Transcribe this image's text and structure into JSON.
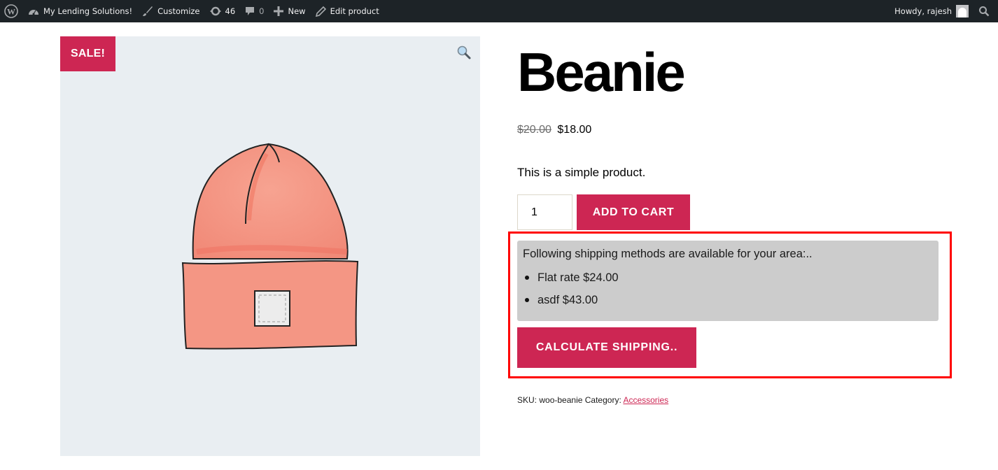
{
  "adminbar": {
    "wp_logo": "wordpress-icon",
    "site_name": "My Lending Solutions!",
    "customize": "Customize",
    "updates_count": "46",
    "comments_count": "0",
    "new": "New",
    "edit": "Edit product",
    "howdy": "Howdy, rajesh",
    "icons": {
      "site": "dashboard-icon",
      "customize": "paintbrush-icon",
      "updates": "refresh-icon",
      "comments": "comment-icon",
      "new": "plus-icon",
      "edit": "pencil-icon",
      "search": "search-icon"
    }
  },
  "gallery": {
    "sale_badge": "SALE!",
    "zoom_icon": "magnifier-icon",
    "image_alt": "Beanie illustration"
  },
  "product": {
    "title": "Beanie",
    "regular_price": "$20.00",
    "sale_price": "$18.00",
    "short_description": "This is a simple product.",
    "quantity": "1",
    "add_to_cart": "ADD TO CART"
  },
  "shipping": {
    "heading": "Following shipping methods are available for your area:..",
    "methods": [
      {
        "label": "Flat rate $24.00"
      },
      {
        "label": "asdf $43.00"
      }
    ],
    "calculate_button": "CALCULATE SHIPPING..",
    "highlight_color": "#ff0000"
  },
  "meta": {
    "sku_label": "SKU:",
    "sku": "woo-beanie",
    "category_label": "Category:",
    "category": "Accessories"
  },
  "colors": {
    "accent": "#cd2653",
    "adminbar": "#1d2327",
    "gallery_bg": "#e9eef2"
  }
}
